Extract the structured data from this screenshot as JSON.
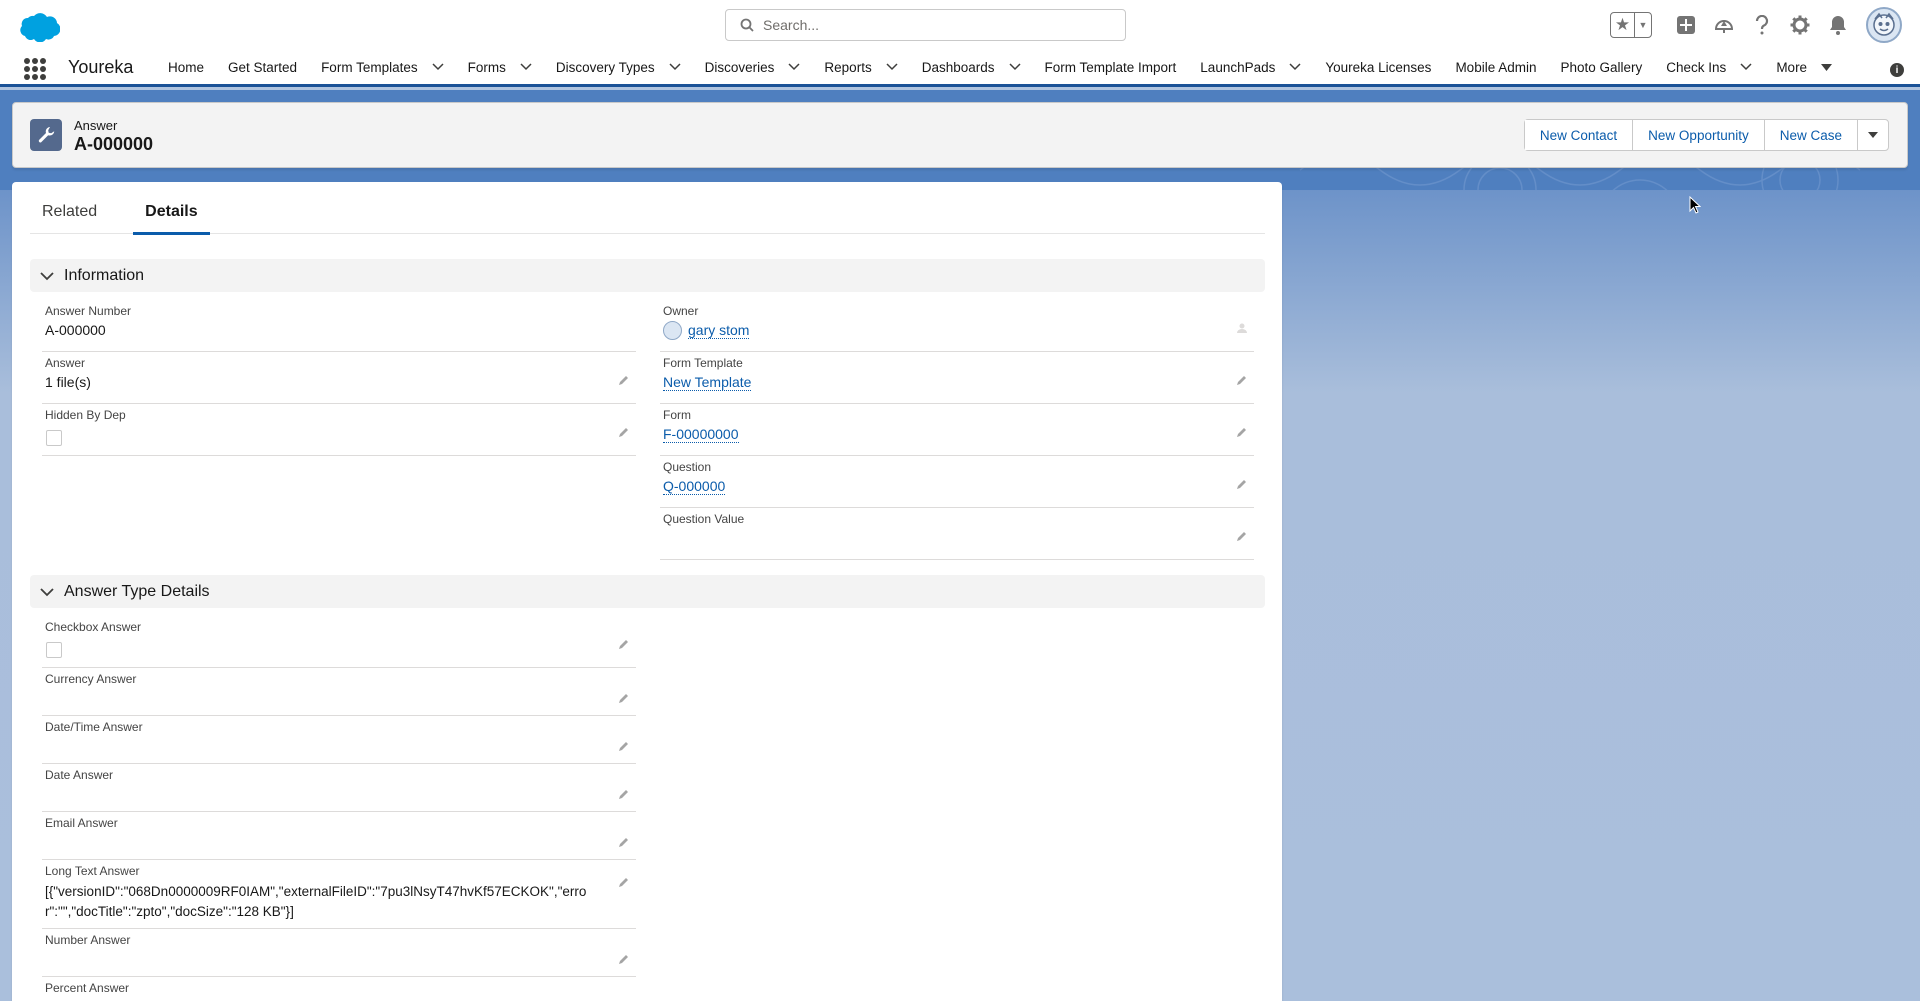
{
  "header": {
    "search_placeholder": "Search...",
    "icons": [
      "favorites-star-icon",
      "add-icon",
      "trailhead-icon",
      "help-icon",
      "setup-gear-icon",
      "notifications-bell-icon",
      "user-avatar"
    ]
  },
  "nav": {
    "app_name": "Youreka",
    "items": [
      {
        "label": "Home",
        "dropdown": false
      },
      {
        "label": "Get Started",
        "dropdown": false
      },
      {
        "label": "Form Templates",
        "dropdown": true
      },
      {
        "label": "Forms",
        "dropdown": true
      },
      {
        "label": "Discovery Types",
        "dropdown": true
      },
      {
        "label": "Discoveries",
        "dropdown": true
      },
      {
        "label": "Reports",
        "dropdown": true
      },
      {
        "label": "Dashboards",
        "dropdown": true
      },
      {
        "label": "Form Template Import",
        "dropdown": false
      },
      {
        "label": "LaunchPads",
        "dropdown": true
      },
      {
        "label": "Youreka Licenses",
        "dropdown": false
      },
      {
        "label": "Mobile Admin",
        "dropdown": false
      },
      {
        "label": "Photo Gallery",
        "dropdown": false
      },
      {
        "label": "Check Ins",
        "dropdown": true
      },
      {
        "label": "More",
        "dropdown": true
      }
    ]
  },
  "record": {
    "type": "Answer",
    "title": "A-000000",
    "actions": [
      "New Contact",
      "New Opportunity",
      "New Case"
    ]
  },
  "tabs": [
    "Related",
    "Details"
  ],
  "active_tab": "Details",
  "sections": {
    "information": {
      "title": "Information",
      "left": [
        {
          "label": "Answer Number",
          "value": "A-000000"
        },
        {
          "label": "Answer",
          "value": "1 file(s)"
        },
        {
          "label": "Hidden By Dep",
          "value": ""
        }
      ],
      "right": [
        {
          "label": "Owner",
          "value": "gary stom"
        },
        {
          "label": "Form Template",
          "value": "New Template"
        },
        {
          "label": "Form",
          "value": "F-00000000"
        },
        {
          "label": "Question",
          "value": "Q-000000"
        },
        {
          "label": "Question Value",
          "value": ""
        }
      ]
    },
    "answer_type_details": {
      "title": "Answer Type Details",
      "fields": [
        {
          "label": "Checkbox Answer",
          "value": ""
        },
        {
          "label": "Currency Answer",
          "value": ""
        },
        {
          "label": "Date/Time Answer",
          "value": ""
        },
        {
          "label": "Date Answer",
          "value": ""
        },
        {
          "label": "Email Answer",
          "value": ""
        },
        {
          "label": "Long Text Answer",
          "value": "[{\"versionID\":\"068Dn0000009RF0IAM\",\"externalFileID\":\"7pu3lNsyT47hvKf57ECKOK\",\"error\":\"\",\"docTitle\":\"zpto\",\"docSize\":\"128 KB\"}]"
        },
        {
          "label": "Number Answer",
          "value": ""
        },
        {
          "label": "Percent Answer",
          "value": ""
        }
      ]
    }
  },
  "colors": {
    "brand_blue": "#0b5cab",
    "nav_underline": "#1b5297",
    "record_icon": "#54698d"
  }
}
